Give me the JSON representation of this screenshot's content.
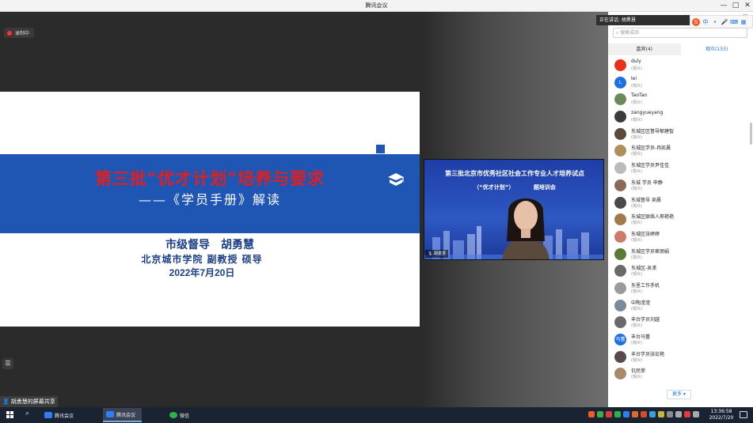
{
  "window": {
    "title": "腾讯会议",
    "minimize": "—",
    "maximize": "□",
    "close": "✕"
  },
  "recording": {
    "label": "录制中"
  },
  "slide": {
    "title": "第三批“优才计划”培养与要求",
    "subtitle": "——《学员手册》解读",
    "presenter": "市级督导　胡勇慧",
    "affiliation": "北京城市学院 副教授 硕导",
    "date": "2022年7月20日"
  },
  "video": {
    "banner_line1": "第三批北京市优秀社区社会工作专业人才培养试点",
    "banner_line2": "（“优才计划”）　　　　题培训会",
    "speaker_name": "胡勇慧"
  },
  "share_status": "胡勇慧的屏幕共享",
  "panel": {
    "speaking_label": "正在讲话: 胡勇慧",
    "search_placeholder": "搜索成员",
    "tabs": [
      {
        "label": "嘉宾(4)"
      },
      {
        "label": "观众(153)"
      }
    ],
    "role_label": "(观众)",
    "members": [
      {
        "name": "duly",
        "avatar_text": "",
        "color": "#e8321b"
      },
      {
        "name": "lei",
        "avatar_text": "L",
        "color": "#1f6fe0"
      },
      {
        "name": "TaoTao",
        "avatar_text": "",
        "color": "#6b8a5a"
      },
      {
        "name": "zangyueyang",
        "avatar_text": "",
        "color": "#3b3b3b"
      },
      {
        "name": "东城区区督导郁建智",
        "avatar_text": "",
        "color": "#5a4a3a"
      },
      {
        "name": "东城区学员-冉凯晨",
        "avatar_text": "",
        "color": "#b0905a"
      },
      {
        "name": "东城区学员尹佳佳",
        "avatar_text": "",
        "color": "#bbbbbb"
      },
      {
        "name": "东城 学员 申静",
        "avatar_text": "",
        "color": "#8a6a5a"
      },
      {
        "name": "东城督导 吴晨",
        "avatar_text": "",
        "color": "#4a4a4a"
      },
      {
        "name": "东城区联络人邢艳艳",
        "avatar_text": "",
        "color": "#a07a4a"
      },
      {
        "name": "东城区张婷婷",
        "avatar_text": "",
        "color": "#d07a6a"
      },
      {
        "name": "东城区学员崔丽娟",
        "avatar_text": "",
        "color": "#5a7a3a"
      },
      {
        "name": "东城区-吴潆",
        "avatar_text": "",
        "color": "#6a6a6a"
      },
      {
        "name": "东里工作手机",
        "avatar_text": "",
        "color": "#9a9a9a"
      },
      {
        "name": "中陶滢滢",
        "avatar_text": "",
        "color": "#7a8a9a"
      },
      {
        "name": "丰台学员刘越",
        "avatar_text": "",
        "color": "#6a6a6a"
      },
      {
        "name": "丰台马蕾",
        "avatar_text": "马蕾",
        "color": "#1f6fe0"
      },
      {
        "name": "丰台学员张宏艳",
        "avatar_text": "",
        "color": "#5a4a4a"
      },
      {
        "name": "仉民荣",
        "avatar_text": "",
        "color": "#aa8a6a"
      }
    ],
    "more_label": "更多 ▾"
  },
  "taskbar": {
    "apps": [
      {
        "label": "腾讯会议"
      },
      {
        "label": "腾讯会议"
      },
      {
        "label": "微信"
      }
    ],
    "time": "13:36:58",
    "date": "2022/7/20"
  }
}
